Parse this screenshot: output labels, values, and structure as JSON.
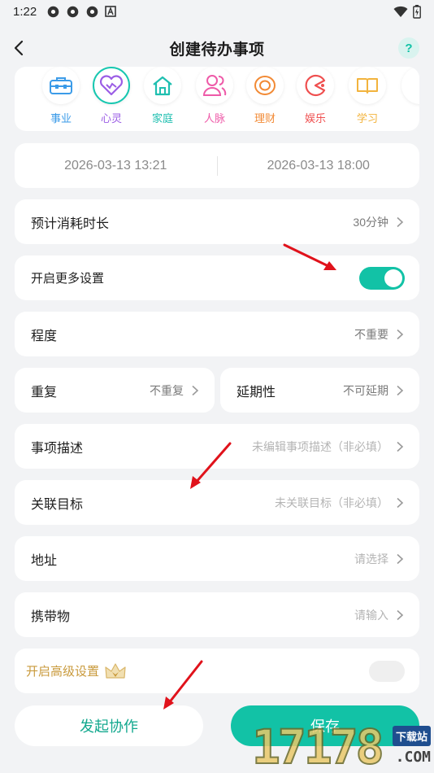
{
  "status": {
    "time": "1:22"
  },
  "header": {
    "title": "创建待办事项",
    "help_label": "?"
  },
  "categories": [
    {
      "label": "事业",
      "color": "#3b9be8",
      "icon": "briefcase-icon"
    },
    {
      "label": "心灵",
      "color": "#9b5de5",
      "icon": "heart-icon",
      "selected": true
    },
    {
      "label": "家庭",
      "color": "#1fbfb0",
      "icon": "home-icon"
    },
    {
      "label": "人脉",
      "color": "#ee5aa8",
      "icon": "people-icon"
    },
    {
      "label": "理财",
      "color": "#f28a35",
      "icon": "coin-icon"
    },
    {
      "label": "娱乐",
      "color": "#ef4f4f",
      "icon": "pacman-icon"
    },
    {
      "label": "学习",
      "color": "#f2b33d",
      "icon": "book-icon"
    }
  ],
  "dates": {
    "start": "2026-03-13 13:21",
    "end": "2026-03-13 18:00"
  },
  "rows": {
    "duration": {
      "label": "预计消耗时长",
      "value": "30分钟"
    },
    "more_settings": {
      "label": "开启更多设置"
    },
    "level": {
      "label": "程度",
      "value": "不重要"
    },
    "repeat": {
      "label": "重复",
      "value": "不重复"
    },
    "delay": {
      "label": "延期性",
      "value": "不可延期"
    },
    "description": {
      "label": "事项描述",
      "value": "未编辑事项描述（非必填）"
    },
    "goal": {
      "label": "关联目标",
      "value": "未关联目标（非必填）"
    },
    "address": {
      "label": "地址",
      "value": "请选择"
    },
    "carry": {
      "label": "携带物",
      "value": "请输入"
    },
    "advanced": {
      "label": "开启高级设置"
    }
  },
  "buttons": {
    "collab": "发起协作",
    "save": "保存"
  },
  "watermark": {
    "text": "17178",
    "badge": "下载站",
    "domain": ".COM"
  },
  "colors": {
    "accent": "#12c2a6",
    "arrow": "#e0121b",
    "gold": "#c99a3c"
  }
}
